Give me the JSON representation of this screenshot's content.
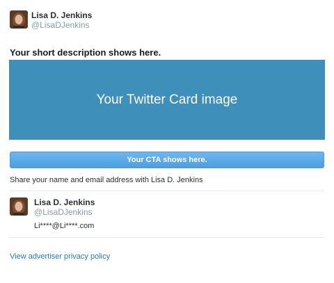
{
  "header": {
    "name": "Lisa D. Jenkins",
    "handle": "@LisaDJenkins"
  },
  "card": {
    "short_description": "Your short description shows here.",
    "image_text": "Your Twitter Card image",
    "cta_label": "Your CTA shows here.",
    "share_text": "Share your name and email address with Lisa D. Jenkins"
  },
  "user": {
    "name": "Lisa D. Jenkins",
    "handle": "@LisaDJenkins",
    "email": "Li****@Li****.com"
  },
  "footer": {
    "privacy_link": "View advertiser privacy policy"
  },
  "colors": {
    "card_image_bg": "#3f8fbb",
    "cta_bg": "#5aa8e8",
    "link": "#2b7bb9",
    "handle_gray": "#8899a6"
  }
}
